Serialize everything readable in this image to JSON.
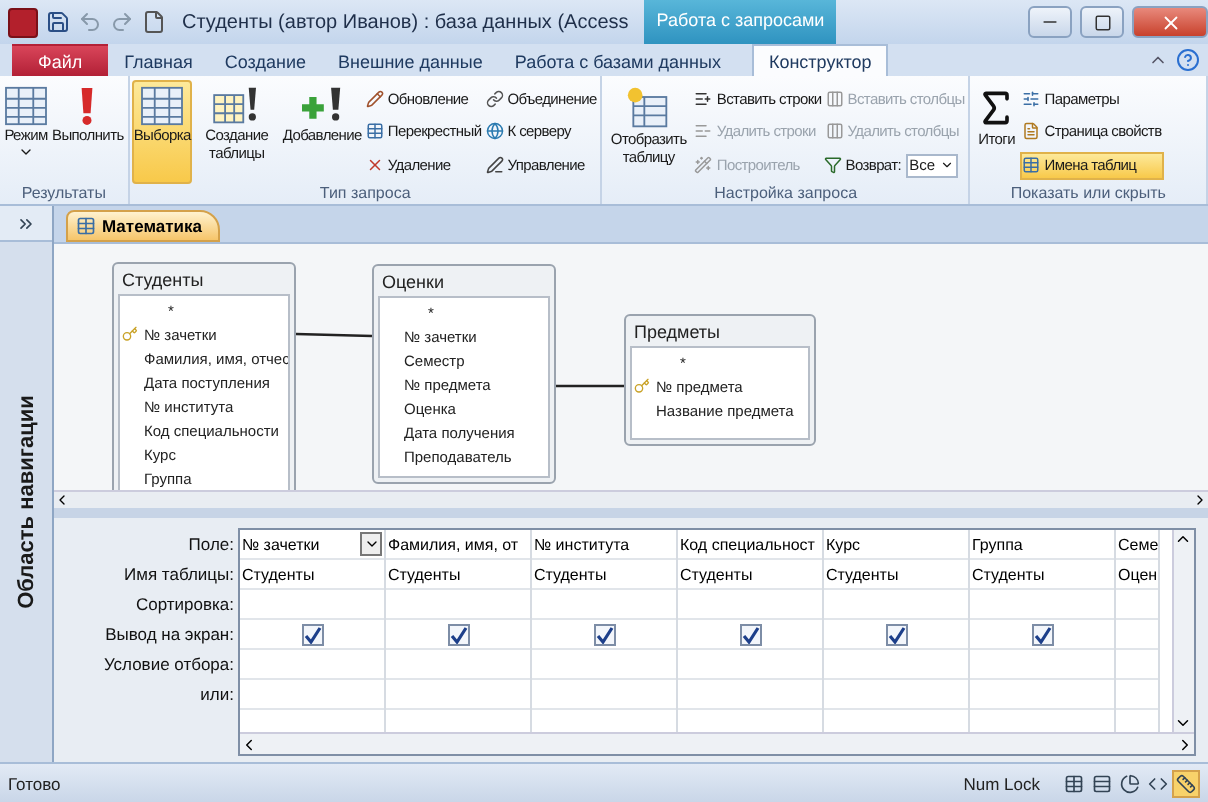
{
  "window": {
    "title": "Студенты (автор Иванов) : база данных (Access",
    "context_tab": "Работа с запросами"
  },
  "ribbon_tabs": [
    {
      "label": "Файл",
      "kind": "file",
      "selected": false
    },
    {
      "label": "Главная",
      "kind": "tab",
      "selected": false
    },
    {
      "label": "Создание",
      "kind": "tab",
      "selected": false
    },
    {
      "label": "Внешние данные",
      "kind": "tab",
      "selected": false
    },
    {
      "label": "Работа с базами данных",
      "kind": "tab",
      "selected": false
    },
    {
      "label": "Конструктор",
      "kind": "context",
      "selected": true
    }
  ],
  "ribbon_groups": [
    {
      "label": "Результаты",
      "large": [
        {
          "label": "Режим",
          "dropdown": true,
          "selected": false
        },
        {
          "label": "Выполнить",
          "selected": false
        }
      ]
    },
    {
      "label": "Тип запроса",
      "large": [
        {
          "label": "Выборка",
          "selected": true
        },
        {
          "label": "Создание таблицы",
          "selected": false
        },
        {
          "label": "Добавление",
          "selected": false
        }
      ],
      "small_columns": [
        [
          {
            "label": "Обновление",
            "kind": "button",
            "disabled": false,
            "on": false
          },
          {
            "label": "Перекрестный",
            "kind": "button",
            "disabled": false,
            "on": false
          },
          {
            "label": "Удаление",
            "kind": "button",
            "disabled": false,
            "on": false
          }
        ],
        [
          {
            "label": "Объединение",
            "kind": "button",
            "disabled": false,
            "on": false
          },
          {
            "label": "К серверу",
            "kind": "button",
            "disabled": false,
            "on": false
          },
          {
            "label": "Управление",
            "kind": "button",
            "disabled": false,
            "on": false
          }
        ]
      ]
    },
    {
      "label": "Настройка запроса",
      "large": [
        {
          "label": "Отобразить таблицу",
          "selected": false
        }
      ],
      "small_columns": [
        [
          {
            "label": "Вставить строки",
            "kind": "button",
            "disabled": false,
            "on": false
          },
          {
            "label": "Удалить строки",
            "kind": "button",
            "disabled": true,
            "on": false
          },
          {
            "label": "Построитель",
            "kind": "button",
            "disabled": true,
            "on": false
          }
        ],
        [
          {
            "label": "Вставить столбцы",
            "kind": "button",
            "disabled": true,
            "on": false
          },
          {
            "label": "Удалить столбцы",
            "kind": "button",
            "disabled": true,
            "on": false
          },
          {
            "label": "Возврат:",
            "kind": "combo",
            "value": "Все",
            "disabled": false
          }
        ]
      ]
    },
    {
      "label": "Показать или скрыть",
      "large": [
        {
          "label": "Итоги",
          "selected": false
        }
      ],
      "small_columns": [
        [
          {
            "label": "Параметры",
            "kind": "button",
            "disabled": false,
            "on": false
          },
          {
            "label": "Страница свойств",
            "kind": "button",
            "disabled": false,
            "on": false
          },
          {
            "label": "Имена таблиц",
            "kind": "button",
            "disabled": false,
            "on": true
          }
        ]
      ]
    }
  ],
  "navigation_pane": {
    "label": "Область навигации"
  },
  "document_tab": {
    "label": "Математика",
    "selected": true
  },
  "tables": [
    {
      "name": "Студенты",
      "fields": [
        {
          "name": "*",
          "key": false
        },
        {
          "name": "№ зачетки",
          "key": true
        },
        {
          "name": "Фамилия, имя, отчес",
          "key": false
        },
        {
          "name": "Дата поступления",
          "key": false
        },
        {
          "name": "№ института",
          "key": false
        },
        {
          "name": "Код специальности",
          "key": false
        },
        {
          "name": "Курс",
          "key": false
        },
        {
          "name": "Группа",
          "key": false
        }
      ]
    },
    {
      "name": "Оценки",
      "fields": [
        {
          "name": "*",
          "key": false
        },
        {
          "name": "№ зачетки",
          "key": false
        },
        {
          "name": "Семестр",
          "key": false
        },
        {
          "name": "№ предмета",
          "key": false
        },
        {
          "name": "Оценка",
          "key": false
        },
        {
          "name": "Дата получения",
          "key": false
        },
        {
          "name": "Преподаватель",
          "key": false
        }
      ]
    },
    {
      "name": "Предметы",
      "fields": [
        {
          "name": "*",
          "key": false
        },
        {
          "name": "№ предмета",
          "key": true
        },
        {
          "name": "Название предмета",
          "key": false
        }
      ]
    }
  ],
  "grid": {
    "row_labels": [
      "Поле:",
      "Имя таблицы:",
      "Сортировка:",
      "Вывод на экран:",
      "Условие отбора:",
      "или:"
    ],
    "columns": [
      {
        "field": "№ зачетки",
        "table": "Студенты",
        "show": true,
        "selected": true
      },
      {
        "field": "Фамилия, имя, от",
        "table": "Студенты",
        "show": true,
        "selected": false
      },
      {
        "field": "№ института",
        "table": "Студенты",
        "show": true,
        "selected": false
      },
      {
        "field": "Код специальност",
        "table": "Студенты",
        "show": true,
        "selected": false
      },
      {
        "field": "Курс",
        "table": "Студенты",
        "show": true,
        "selected": false
      },
      {
        "field": "Группа",
        "table": "Студенты",
        "show": true,
        "selected": false
      },
      {
        "field": "Семе",
        "table": "Оцен",
        "selected": false
      }
    ]
  },
  "status_bar": {
    "text": "Готово",
    "num_lock": "Num Lock",
    "views": [
      {
        "selected": false
      },
      {
        "selected": false
      },
      {
        "selected": false
      },
      {
        "selected": false
      },
      {
        "selected": true
      }
    ]
  }
}
